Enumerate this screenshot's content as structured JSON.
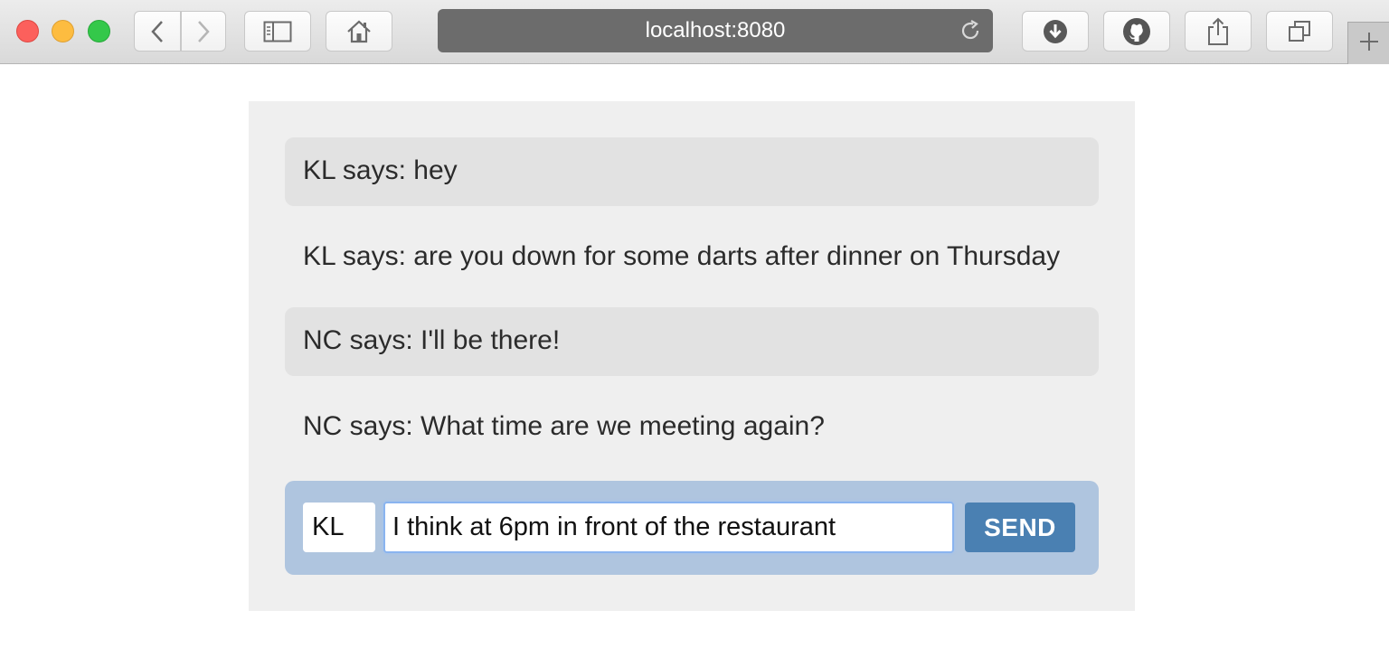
{
  "browser": {
    "url": "localhost:8080",
    "icons": [
      "back-icon",
      "forward-icon",
      "sidebar-icon",
      "home-icon",
      "reload-icon",
      "download-icon",
      "github-icon",
      "share-icon",
      "tabs-icon",
      "new-tab-icon"
    ]
  },
  "messages": [
    {
      "text": "KL says: hey"
    },
    {
      "text": "KL says: are you down for some darts after dinner on Thursday"
    },
    {
      "text": "NC says: I'll be there!"
    },
    {
      "text": "NC says: What time are we meeting again?"
    }
  ],
  "composer": {
    "name_value": "KL",
    "message_value": "I think at 6pm in front of the restaurant",
    "send_label": "SEND"
  },
  "colors": {
    "panel_bg": "#efefef",
    "message_alt_bg": "#e2e2e2",
    "composer_bg": "#afc5df",
    "send_button": "#4a80b2"
  }
}
